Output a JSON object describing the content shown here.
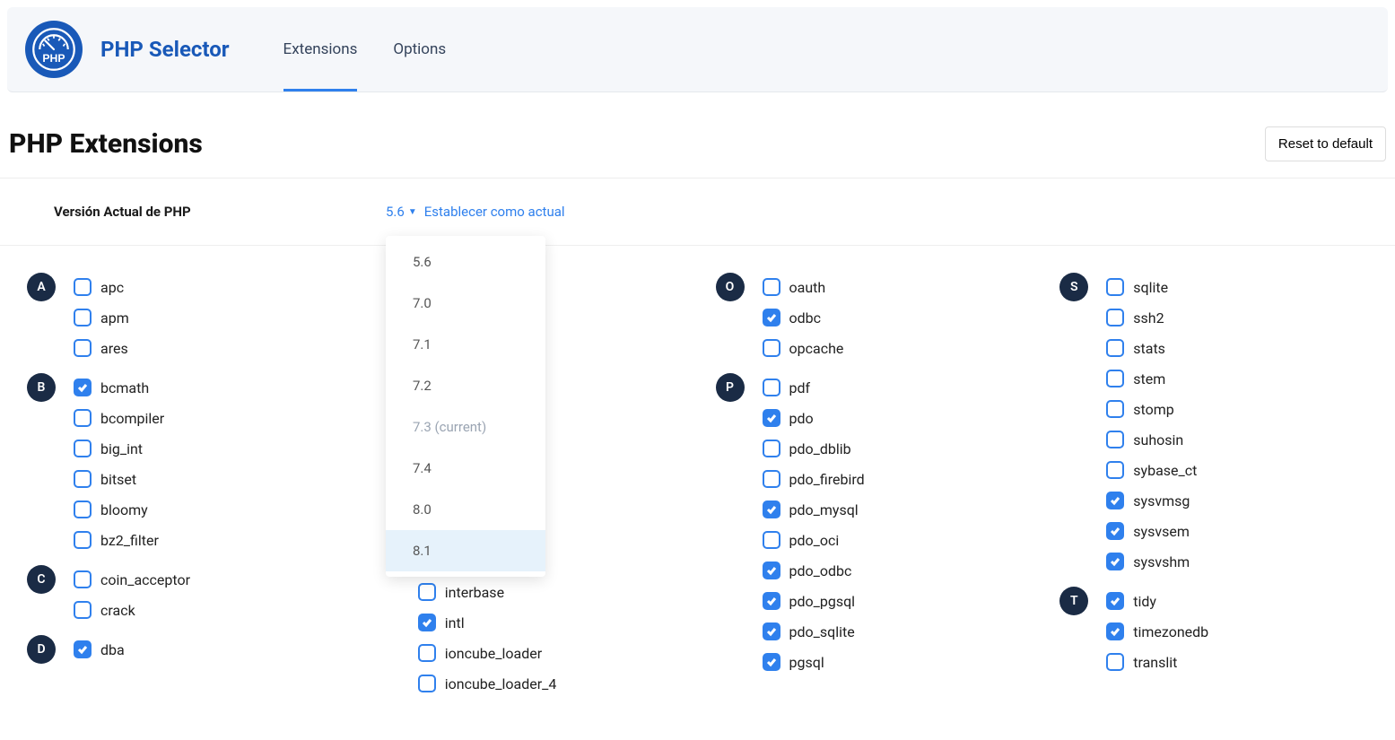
{
  "app_name": "PHP Selector",
  "tabs": {
    "extensions": "Extensions",
    "options": "Options"
  },
  "page_title": "PHP Extensions",
  "reset_button": "Reset to default",
  "version": {
    "label": "Versión Actual de PHP",
    "selected": "5.6",
    "set_current": "Establecer como actual",
    "options": [
      {
        "label": "5.6",
        "disabled": false,
        "hovered": false
      },
      {
        "label": "7.0",
        "disabled": false,
        "hovered": false
      },
      {
        "label": "7.1",
        "disabled": false,
        "hovered": false
      },
      {
        "label": "7.2",
        "disabled": false,
        "hovered": false
      },
      {
        "label": "7.3 (current)",
        "disabled": true,
        "hovered": false
      },
      {
        "label": "7.4",
        "disabled": false,
        "hovered": false
      },
      {
        "label": "8.0",
        "disabled": false,
        "hovered": false
      },
      {
        "label": "8.1",
        "disabled": false,
        "hovered": true
      }
    ]
  },
  "columns": [
    {
      "groups": [
        {
          "letter": "A",
          "items": [
            {
              "name": "apc",
              "checked": false
            },
            {
              "name": "apm",
              "checked": false
            },
            {
              "name": "ares",
              "checked": false
            }
          ]
        },
        {
          "letter": "B",
          "items": [
            {
              "name": "bcmath",
              "checked": true
            },
            {
              "name": "bcompiler",
              "checked": false
            },
            {
              "name": "big_int",
              "checked": false
            },
            {
              "name": "bitset",
              "checked": false
            },
            {
              "name": "bloomy",
              "checked": false
            },
            {
              "name": "bz2_filter",
              "checked": false
            }
          ]
        },
        {
          "letter": "C",
          "items": [
            {
              "name": "coin_acceptor",
              "checked": false
            },
            {
              "name": "crack",
              "checked": false
            }
          ]
        },
        {
          "letter": "D",
          "items": [
            {
              "name": "dba",
              "checked": true
            }
          ]
        }
      ]
    },
    {
      "groups": [
        {
          "letter": "",
          "items": [
            {
              "name": "interbase",
              "checked": false
            },
            {
              "name": "intl",
              "checked": true
            },
            {
              "name": "ioncube_loader",
              "checked": false
            },
            {
              "name": "ioncube_loader_4",
              "checked": false
            }
          ]
        }
      ]
    },
    {
      "groups": [
        {
          "letter": "O",
          "items": [
            {
              "name": "oauth",
              "checked": false
            },
            {
              "name": "odbc",
              "checked": true
            },
            {
              "name": "opcache",
              "checked": false
            }
          ]
        },
        {
          "letter": "P",
          "items": [
            {
              "name": "pdf",
              "checked": false
            },
            {
              "name": "pdo",
              "checked": true
            },
            {
              "name": "pdo_dblib",
              "checked": false
            },
            {
              "name": "pdo_firebird",
              "checked": false
            },
            {
              "name": "pdo_mysql",
              "checked": true
            },
            {
              "name": "pdo_oci",
              "checked": false
            },
            {
              "name": "pdo_odbc",
              "checked": true
            },
            {
              "name": "pdo_pgsql",
              "checked": true
            },
            {
              "name": "pdo_sqlite",
              "checked": true
            },
            {
              "name": "pgsql",
              "checked": true
            }
          ]
        }
      ]
    },
    {
      "groups": [
        {
          "letter": "S",
          "items": [
            {
              "name": "sqlite",
              "checked": false
            },
            {
              "name": "ssh2",
              "checked": false
            },
            {
              "name": "stats",
              "checked": false
            },
            {
              "name": "stem",
              "checked": false
            },
            {
              "name": "stomp",
              "checked": false
            },
            {
              "name": "suhosin",
              "checked": false
            },
            {
              "name": "sybase_ct",
              "checked": false
            },
            {
              "name": "sysvmsg",
              "checked": true
            },
            {
              "name": "sysvsem",
              "checked": true
            },
            {
              "name": "sysvshm",
              "checked": true
            }
          ]
        },
        {
          "letter": "T",
          "items": [
            {
              "name": "tidy",
              "checked": true
            },
            {
              "name": "timezonedb",
              "checked": true
            },
            {
              "name": "translit",
              "checked": false
            }
          ]
        }
      ]
    }
  ]
}
